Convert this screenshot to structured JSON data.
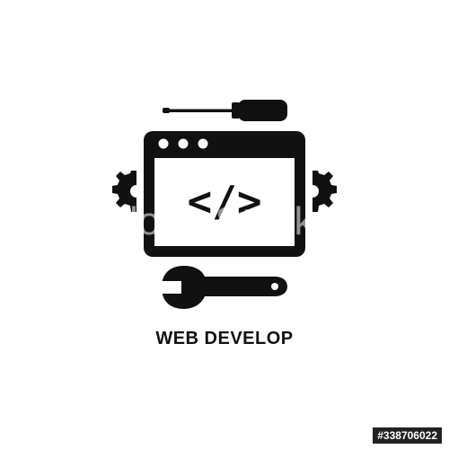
{
  "caption": "WEB DEVELOP",
  "code_symbol": "</>",
  "watermark": "Adobe Stock",
  "stock_id": "#338706022",
  "icons": [
    "screwdriver-icon",
    "browser-window-icon",
    "gear-icon",
    "gear-icon",
    "wrench-icon"
  ],
  "colors": {
    "ink": "#111111",
    "background": "#ffffff"
  }
}
